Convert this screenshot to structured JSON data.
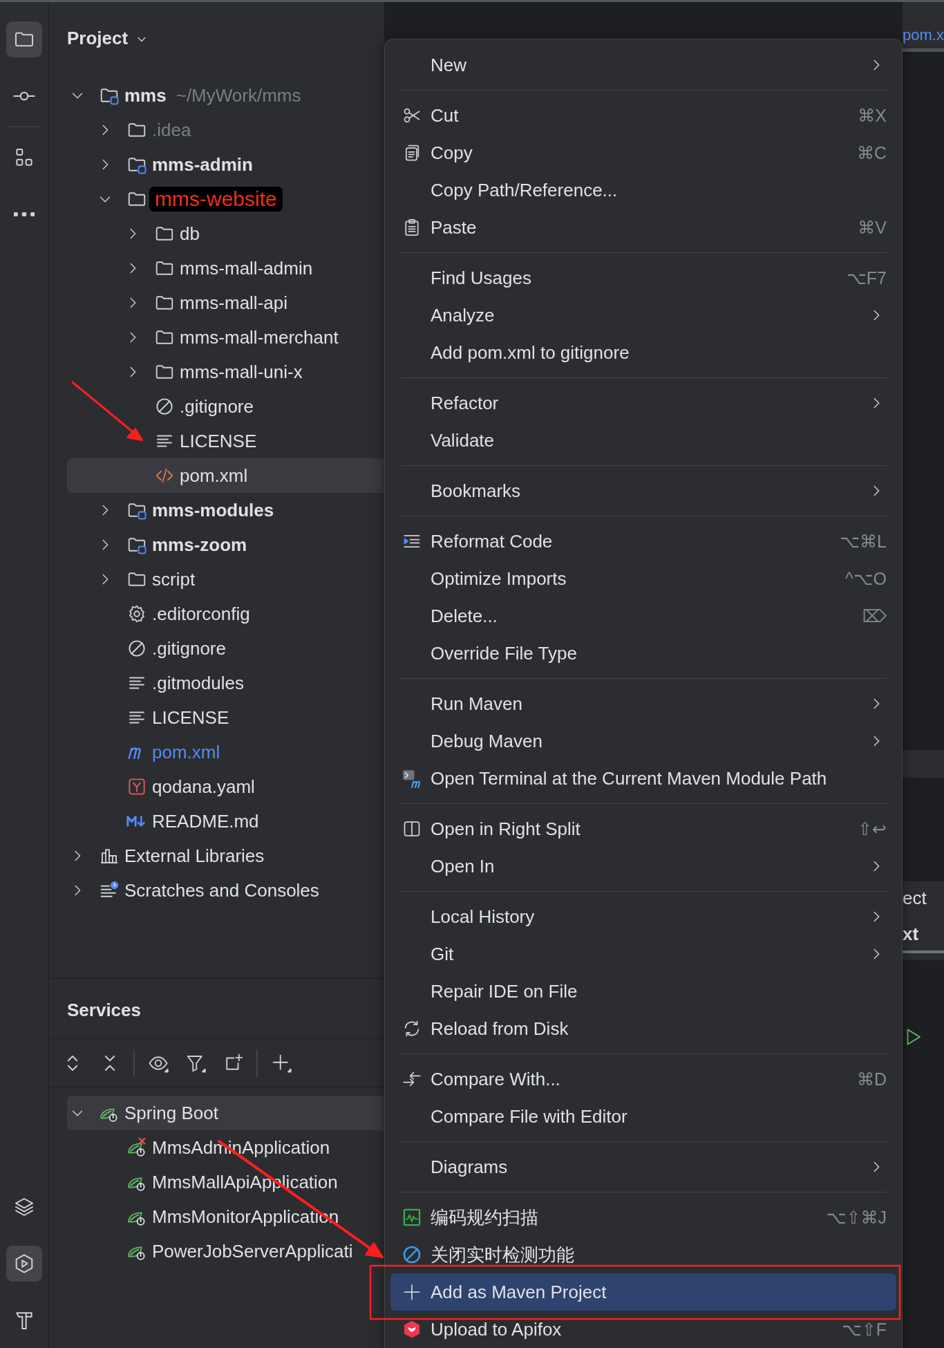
{
  "sidebar": {
    "top_items": [
      {
        "selected": true
      },
      {
        "selected": false
      },
      {
        "selected": false
      },
      {
        "selected": false
      }
    ],
    "bottom_items": [
      {
        "selected": false
      },
      {
        "selected": true
      },
      {
        "selected": false
      }
    ]
  },
  "project": {
    "title": "Project",
    "tree": [
      {
        "name": "mms",
        "path": "~/MyWork/mms",
        "kind": "module",
        "expanded": true,
        "selected": false,
        "children": [
          {
            "name": ".idea",
            "kind": "excluded",
            "expanded": false,
            "selected": false
          },
          {
            "name": "mms-admin",
            "kind": "module",
            "expanded": false,
            "selected": false
          },
          {
            "name": "mms-website",
            "kind": "annotated",
            "expanded": true,
            "selected": false,
            "children": [
              {
                "name": "db",
                "kind": "folder",
                "expanded": false,
                "selected": false
              },
              {
                "name": "mms-mall-admin",
                "kind": "folder",
                "expanded": false,
                "selected": false
              },
              {
                "name": "mms-mall-api",
                "kind": "folder",
                "expanded": false,
                "selected": false
              },
              {
                "name": "mms-mall-merchant",
                "kind": "folder",
                "expanded": false,
                "selected": false
              },
              {
                "name": "mms-mall-uni-x",
                "kind": "folder",
                "expanded": false,
                "selected": false
              },
              {
                "name": ".gitignore",
                "kind": "ignore",
                "selected": false
              },
              {
                "name": "LICENSE",
                "kind": "text",
                "selected": false
              },
              {
                "name": "pom.xml",
                "kind": "xml",
                "selected": true
              }
            ]
          },
          {
            "name": "mms-modules",
            "kind": "module",
            "expanded": false,
            "selected": false
          },
          {
            "name": "mms-zoom",
            "kind": "module",
            "expanded": false,
            "selected": false
          },
          {
            "name": "script",
            "kind": "folder",
            "expanded": false,
            "selected": false
          },
          {
            "name": ".editorconfig",
            "kind": "config",
            "selected": false
          },
          {
            "name": ".gitignore",
            "kind": "ignore",
            "selected": false
          },
          {
            "name": ".gitmodules",
            "kind": "text",
            "selected": false
          },
          {
            "name": "LICENSE",
            "kind": "text",
            "selected": false
          },
          {
            "name": "pom.xml",
            "kind": "maven",
            "selected": false
          },
          {
            "name": "qodana.yaml",
            "kind": "yaml",
            "selected": false
          },
          {
            "name": "README.md",
            "kind": "markdown",
            "selected": false
          }
        ]
      },
      {
        "name": "External Libraries",
        "kind": "library",
        "expanded": false,
        "selected": false
      },
      {
        "name": "Scratches and Consoles",
        "kind": "scratches",
        "expanded": false,
        "selected": false
      }
    ]
  },
  "services": {
    "title": "Services",
    "tree": [
      {
        "name": "Spring Boot",
        "kind": "spring",
        "expanded": true,
        "selected": true,
        "error": false,
        "children": [
          {
            "name": "MmsAdminApplication",
            "kind": "spring",
            "selected": false,
            "error": true
          },
          {
            "name": "MmsMallApiApplication",
            "kind": "spring",
            "selected": false,
            "error": false
          },
          {
            "name": "MmsMonitorApplication",
            "kind": "spring",
            "selected": false,
            "error": false
          },
          {
            "name": "PowerJobServerApplicati",
            "kind": "spring",
            "selected": false,
            "error": false
          }
        ]
      }
    ]
  },
  "context_menu": {
    "items": [
      {
        "kind": "item",
        "label": "New",
        "submenu": true,
        "selected": false
      },
      {
        "kind": "separator"
      },
      {
        "kind": "item",
        "label": "Cut",
        "shortcut": "⌘X",
        "submenu": false,
        "selected": false
      },
      {
        "kind": "item",
        "label": "Copy",
        "shortcut": "⌘C",
        "submenu": false,
        "selected": false
      },
      {
        "kind": "item",
        "label": "Copy Path/Reference...",
        "submenu": false,
        "selected": false
      },
      {
        "kind": "item",
        "label": "Paste",
        "shortcut": "⌘V",
        "submenu": false,
        "selected": false
      },
      {
        "kind": "separator"
      },
      {
        "kind": "item",
        "label": "Find Usages",
        "shortcut": "⌥F7",
        "submenu": false,
        "selected": false
      },
      {
        "kind": "item",
        "label": "Analyze",
        "submenu": true,
        "selected": false
      },
      {
        "kind": "item",
        "label": "Add pom.xml to gitignore",
        "submenu": false,
        "selected": false
      },
      {
        "kind": "separator"
      },
      {
        "kind": "item",
        "label": "Refactor",
        "submenu": true,
        "selected": false
      },
      {
        "kind": "item",
        "label": "Validate",
        "submenu": false,
        "selected": false
      },
      {
        "kind": "separator"
      },
      {
        "kind": "item",
        "label": "Bookmarks",
        "submenu": true,
        "selected": false
      },
      {
        "kind": "separator"
      },
      {
        "kind": "item",
        "label": "Reformat Code",
        "shortcut": "⌥⌘L",
        "submenu": false,
        "selected": false
      },
      {
        "kind": "item",
        "label": "Optimize Imports",
        "shortcut": "^⌥O",
        "submenu": false,
        "selected": false
      },
      {
        "kind": "item",
        "label": "Delete...",
        "shortcut": "⌦",
        "submenu": false,
        "selected": false
      },
      {
        "kind": "item",
        "label": "Override File Type",
        "submenu": false,
        "selected": false
      },
      {
        "kind": "separator"
      },
      {
        "kind": "item",
        "label": "Run Maven",
        "submenu": true,
        "selected": false
      },
      {
        "kind": "item",
        "label": "Debug Maven",
        "submenu": true,
        "selected": false
      },
      {
        "kind": "item",
        "label": "Open Terminal at the Current Maven Module Path",
        "submenu": false,
        "selected": false
      },
      {
        "kind": "separator"
      },
      {
        "kind": "item",
        "label": "Open in Right Split",
        "shortcut": "⇧↩",
        "submenu": false,
        "selected": false
      },
      {
        "kind": "item",
        "label": "Open In",
        "submenu": true,
        "selected": false
      },
      {
        "kind": "separator"
      },
      {
        "kind": "item",
        "label": "Local History",
        "submenu": true,
        "selected": false
      },
      {
        "kind": "item",
        "label": "Git",
        "submenu": true,
        "selected": false
      },
      {
        "kind": "item",
        "label": "Repair IDE on File",
        "submenu": false,
        "selected": false
      },
      {
        "kind": "item",
        "label": "Reload from Disk",
        "submenu": false,
        "selected": false
      },
      {
        "kind": "separator"
      },
      {
        "kind": "item",
        "label": "Compare With...",
        "shortcut": "⌘D",
        "submenu": false,
        "selected": false
      },
      {
        "kind": "item",
        "label": "Compare File with Editor",
        "submenu": false,
        "selected": false
      },
      {
        "kind": "separator"
      },
      {
        "kind": "item",
        "label": "Diagrams",
        "submenu": true,
        "selected": false
      },
      {
        "kind": "separator"
      },
      {
        "kind": "item",
        "label": "编码规约扫描",
        "shortcut": "⌥⇧⌘J",
        "submenu": false,
        "selected": false
      },
      {
        "kind": "item",
        "label": "关闭实时检测功能",
        "submenu": false,
        "selected": false
      },
      {
        "kind": "item",
        "label": "Add as Maven Project",
        "submenu": false,
        "selected": true
      },
      {
        "kind": "item",
        "label": "Upload to Apifox",
        "shortcut": "⌥⇧F",
        "submenu": false,
        "selected": false
      }
    ]
  },
  "editor": {
    "file_tab": "pom.x",
    "tabs": [
      {
        "label": "ect",
        "selected": false
      },
      {
        "label": "xt",
        "selected": true
      }
    ]
  }
}
